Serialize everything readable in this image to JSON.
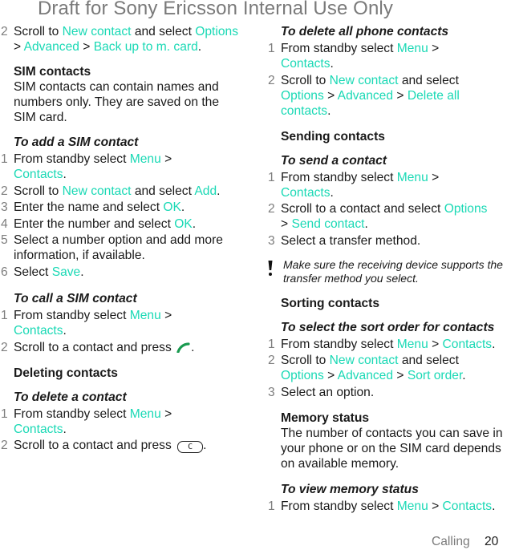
{
  "watermark": "Draft for Sony Ericsson Internal Use Only",
  "colors": {
    "link": "#1ad9b5",
    "step_number": "#7d7d7d",
    "call_icon": "#1a9a50"
  },
  "left": {
    "intro_step": {
      "num": "2",
      "t1": "Scroll to ",
      "l1": "New contact",
      "t2": " and select ",
      "l2": "Options",
      "t3": " > ",
      "l3": "Advanced",
      "t4": " > ",
      "l4": "Back up to m. card",
      "t5": "."
    },
    "sim_contacts": {
      "heading": "SIM contacts",
      "body": "SIM contacts can contain names and numbers only. They are saved on the SIM card."
    },
    "add_sim": {
      "title": "To add a SIM contact",
      "steps": [
        {
          "num": "1",
          "t1": "From standby select ",
          "l1": "Menu",
          "t2": " > ",
          "l2": "Contacts",
          "t3": "."
        },
        {
          "num": "2",
          "t1": "Scroll to ",
          "l1": "New contact",
          "t2": " and select ",
          "l2": "Add",
          "t3": "."
        },
        {
          "num": "3",
          "t1": "Enter the name and select ",
          "l1": "OK",
          "t2": "."
        },
        {
          "num": "4",
          "t1": "Enter the number and select ",
          "l1": "OK",
          "t2": "."
        },
        {
          "num": "5",
          "t1": "Select a number option and add more information, if available."
        },
        {
          "num": "6",
          "t1": "Select ",
          "l1": "Save",
          "t2": "."
        }
      ]
    },
    "call_sim": {
      "title": "To call a SIM contact",
      "steps": [
        {
          "num": "1",
          "t1": "From standby select ",
          "l1": "Menu",
          "t2": " > ",
          "l2": "Contacts",
          "t3": "."
        },
        {
          "num": "2",
          "t1": "Scroll to a contact and press ",
          "icon": "call-key-icon",
          "t2": "."
        }
      ]
    },
    "deleting": {
      "heading": "Deleting contacts",
      "title": "To delete a contact",
      "steps": [
        {
          "num": "1",
          "t1": "From standby select ",
          "l1": "Menu",
          "t2": " > ",
          "l2": "Contacts",
          "t3": "."
        },
        {
          "num": "2",
          "t1": "Scroll to a contact and press ",
          "key": "C",
          "t2": "."
        }
      ]
    }
  },
  "right": {
    "delete_all": {
      "title": "To delete all phone contacts",
      "steps": [
        {
          "num": "1",
          "t1": "From standby select ",
          "l1": "Menu",
          "t2": " > ",
          "l2": "Contacts",
          "t3": "."
        },
        {
          "num": "2",
          "t1": "Scroll to ",
          "l1": "New contact",
          "t2": " and select ",
          "l2": "Options",
          "t3": " > ",
          "l3": "Advanced",
          "t4": " > ",
          "l4": "Delete all contacts",
          "t5": "."
        }
      ]
    },
    "sending": {
      "heading": "Sending contacts",
      "title": "To send a contact",
      "steps": [
        {
          "num": "1",
          "t1": "From standby select ",
          "l1": "Menu",
          "t2": " > ",
          "l2": "Contacts",
          "t3": "."
        },
        {
          "num": "2",
          "t1": "Scroll to a contact and select ",
          "l1": "Options",
          "t2": " > ",
          "l2": "Send contact",
          "t3": "."
        },
        {
          "num": "3",
          "t1": "Select a transfer method."
        }
      ],
      "note": "Make sure the receiving device supports the transfer method you select.",
      "note_icon": "exclamation-icon"
    },
    "sorting": {
      "heading": "Sorting contacts",
      "title": "To select the sort order for contacts",
      "steps": [
        {
          "num": "1",
          "t1": "From standby select ",
          "l1": "Menu",
          "t2": " > ",
          "l2": "Contacts",
          "t3": "."
        },
        {
          "num": "2",
          "t1": "Scroll to ",
          "l1": "New contact",
          "t2": " and select ",
          "l2": "Options",
          "t3": " > ",
          "l3": "Advanced",
          "t4": " > ",
          "l4": "Sort order",
          "t5": "."
        },
        {
          "num": "3",
          "t1": "Select an option."
        }
      ]
    },
    "memory": {
      "heading": "Memory status",
      "body": "The number of contacts you can save in your phone or on the SIM card depends on available memory.",
      "title": "To view memory status",
      "steps": [
        {
          "num": "1",
          "t1": "From standby select ",
          "l1": "Menu",
          "t2": " > ",
          "l2": "Contacts",
          "t3": "."
        }
      ]
    }
  },
  "footer": {
    "section": "Calling",
    "page": "20"
  }
}
